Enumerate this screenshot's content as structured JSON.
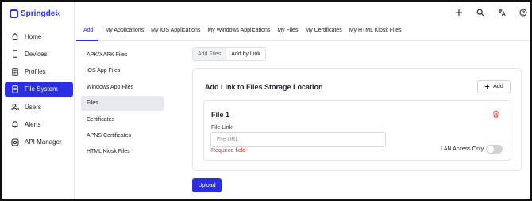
{
  "brand": {
    "name": "Springdel",
    "collapse": "«"
  },
  "sidebar": {
    "items": [
      {
        "label": "Home",
        "icon": "home-icon",
        "active": false
      },
      {
        "label": "Devices",
        "icon": "phone-icon",
        "active": false
      },
      {
        "label": "Profiles",
        "icon": "document-icon",
        "active": false
      },
      {
        "label": "File System",
        "icon": "file-icon",
        "active": true
      },
      {
        "label": "Users",
        "icon": "users-icon",
        "active": false
      },
      {
        "label": "Alerts",
        "icon": "bell-icon",
        "active": false
      },
      {
        "label": "API Manager",
        "icon": "gear-icon",
        "active": false
      }
    ]
  },
  "topbar": {
    "icons": [
      "plus-icon",
      "search-icon",
      "translate-icon",
      "help-icon"
    ]
  },
  "tabs": [
    {
      "label": "Add",
      "active": true
    },
    {
      "label": "My Applications",
      "active": false
    },
    {
      "label": "My iOS Applications",
      "active": false
    },
    {
      "label": "My Windows Applications",
      "active": false
    },
    {
      "label": "My Files",
      "active": false
    },
    {
      "label": "My Certificates",
      "active": false
    },
    {
      "label": "My HTML Kiosk Files",
      "active": false
    }
  ],
  "subnav": [
    {
      "label": "APK/XAPK Files",
      "active": false
    },
    {
      "label": "iOS App Files",
      "active": false
    },
    {
      "label": "Windows App Files",
      "active": false
    },
    {
      "label": "Files",
      "active": true
    },
    {
      "label": "Certificates",
      "active": false
    },
    {
      "label": "APNS Certificates",
      "active": false
    },
    {
      "label": "HTML Kiosk Files",
      "active": false
    }
  ],
  "segmented": {
    "option1": "Add Files",
    "option2": "Add by Link",
    "selected": "Add by Link"
  },
  "card": {
    "title": "Add Link to Files Storage Location",
    "add_label": "Add",
    "file": {
      "title": "File 1",
      "field_label": "File Link",
      "required_mark": "*",
      "placeholder": "File URL",
      "value": "",
      "error": "Required field",
      "lan_label": "LAN Access Only",
      "lan_on": false
    }
  },
  "upload_label": "Upload",
  "colors": {
    "accent": "#2a2ee0",
    "error": "#d93025"
  }
}
